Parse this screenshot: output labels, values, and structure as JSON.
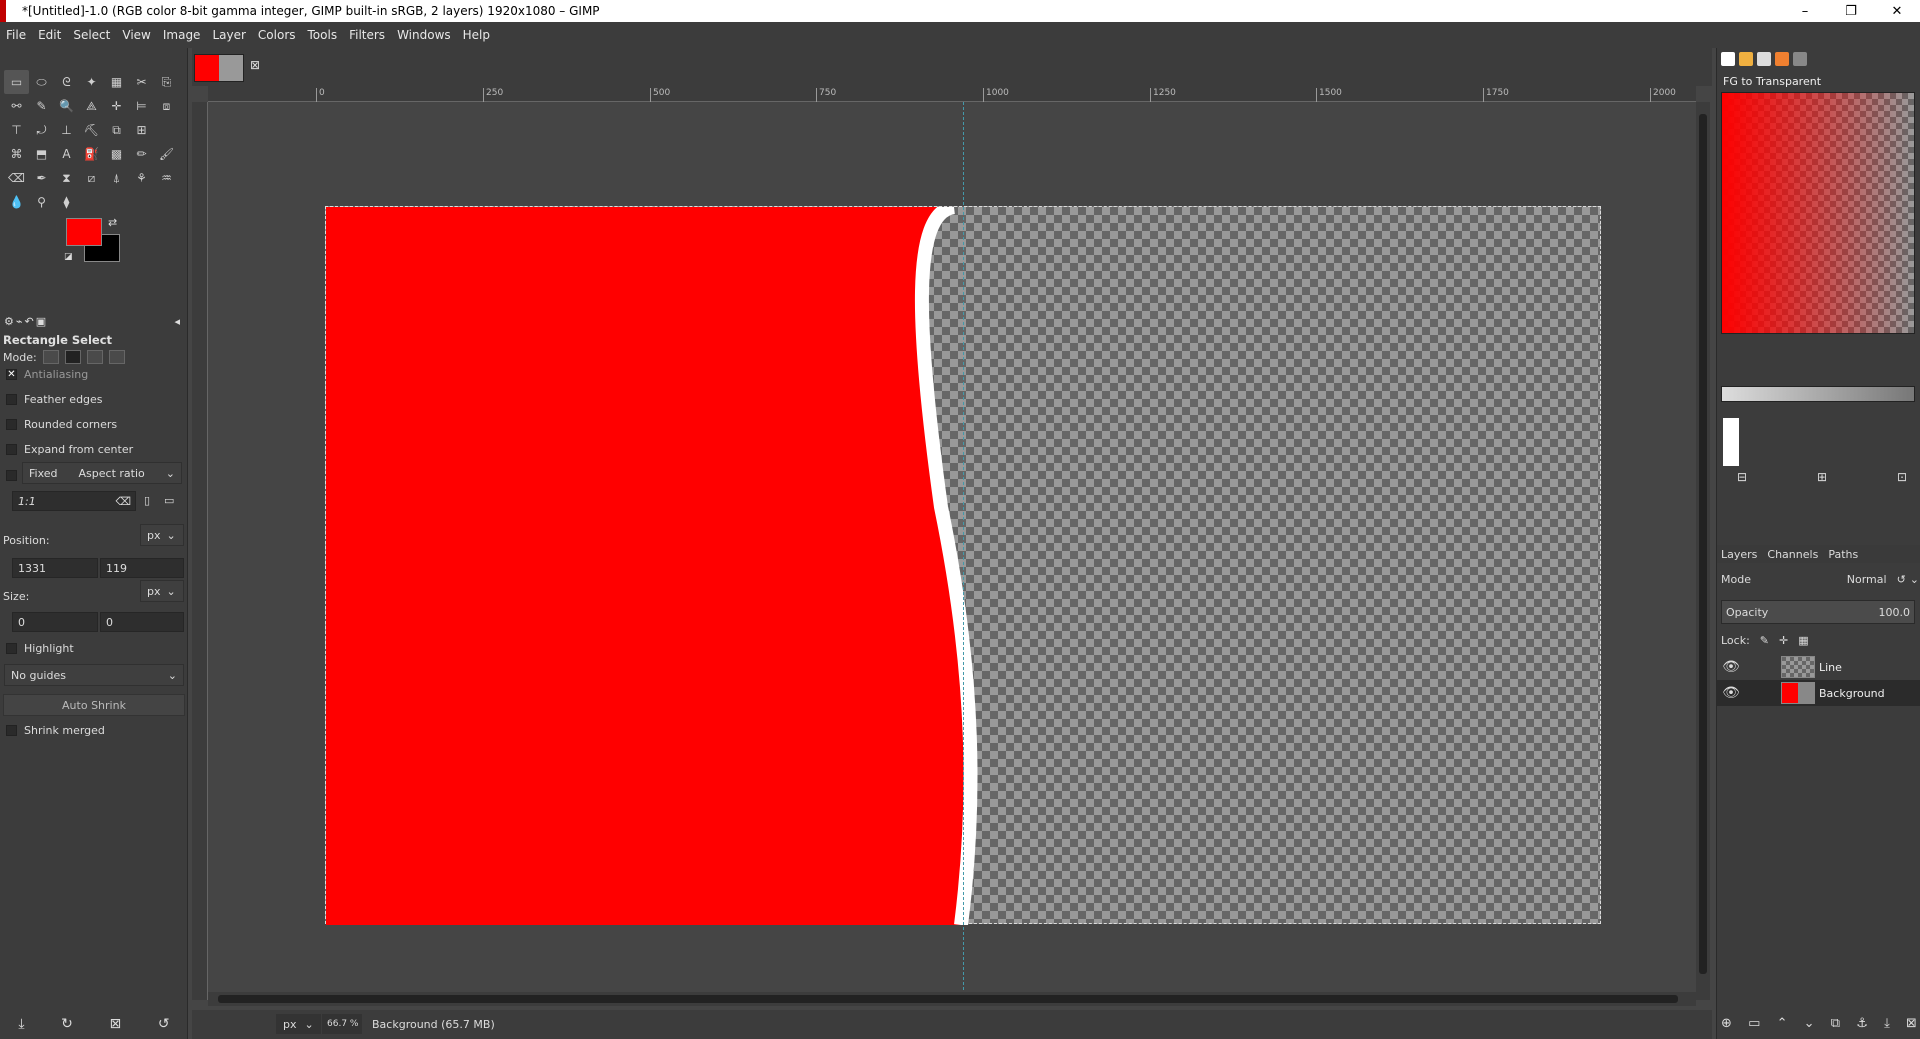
{
  "window": {
    "title": "*[Untitled]-1.0 (RGB color 8-bit gamma integer, GIMP built-in sRGB, 2 layers) 1920x1080 – GIMP",
    "controls": [
      "–",
      "❐",
      "✕"
    ]
  },
  "menu": [
    "File",
    "Edit",
    "Select",
    "View",
    "Image",
    "Layer",
    "Colors",
    "Tools",
    "Filters",
    "Windows",
    "Help"
  ],
  "toolbox": {
    "tools": [
      "▭",
      "⬭",
      "ᘓ",
      "✦",
      "▦",
      "✂",
      "⎘",
      "⚯",
      "✎",
      "🔍",
      "⟁",
      "✛",
      "⊨",
      "⧈",
      "⊤",
      "⤾",
      "⊥",
      "⛏",
      "⧉",
      "⊞",
      "",
      "⌘",
      "⬒",
      "A",
      "⛽",
      "▩",
      "✏",
      "🖌",
      "⌫",
      "✒",
      "⧗",
      "⧄",
      "⍋",
      "⚘",
      "♒",
      "💧",
      "⚲",
      "⧫",
      "",
      "",
      "",
      ""
    ],
    "fg_color": "#ff0000",
    "bg_color": "#000000"
  },
  "tool_options": {
    "title": "Rectangle Select",
    "mode_label": "Mode:",
    "antialiasing": "Antialiasing",
    "feather": "Feather edges",
    "rounded": "Rounded corners",
    "expand": "Expand from center",
    "fixed": "Fixed",
    "fixed_kind": "Aspect ratio",
    "ratio": "1:1",
    "position_label": "Position:",
    "position_unit": "px",
    "pos_x": "1331",
    "pos_y": "119",
    "size_label": "Size:",
    "size_unit": "px",
    "size_w": "0",
    "size_h": "0",
    "highlight": "Highlight",
    "guides": "No guides",
    "auto_shrink": "Auto Shrink",
    "shrink_merged": "Shrink merged"
  },
  "ruler": {
    "marks": [
      "0",
      "250",
      "500",
      "750",
      "1000",
      "1250",
      "1500",
      "1750",
      "2000"
    ]
  },
  "status": {
    "unit": "px",
    "zoom": "66.7 %",
    "text": "Background (65.7 MB)"
  },
  "gradient_panel": {
    "name": "FG to Transparent"
  },
  "layers_panel": {
    "tabs": [
      "Layers",
      "Channels",
      "Paths"
    ],
    "mode_label": "Mode",
    "mode_value": "Normal",
    "opacity_label": "Opacity",
    "opacity_value": "100.0",
    "lock_label": "Lock:",
    "layers": [
      {
        "name": "Line",
        "selected": false
      },
      {
        "name": "Background",
        "selected": true
      }
    ]
  }
}
